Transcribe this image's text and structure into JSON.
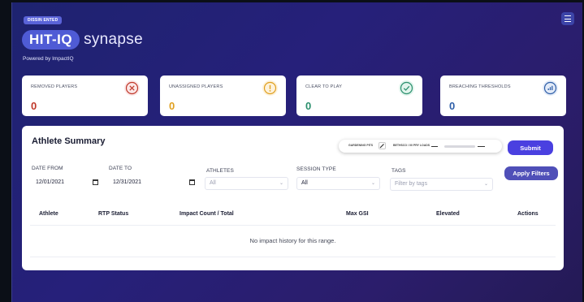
{
  "header": {
    "env_tag": "DISSIN ENTED",
    "logo_badge": "HIT-IQ",
    "logo_word": "synapse",
    "powered_by": "Powered by ImpactIQ"
  },
  "stats": [
    {
      "label": "REMOVED PLAYERS",
      "value": "0",
      "color": "#c0392b",
      "icon": "x-circle-icon"
    },
    {
      "label": "UNASSIGNED PLAYERS",
      "value": "0",
      "color": "#e0a020",
      "icon": "exclamation-icon"
    },
    {
      "label": "CLEAR TO PLAY",
      "value": "0",
      "color": "#2a8f6d",
      "icon": "check-circle-icon"
    },
    {
      "label": "BREACHING THRESHOLDS",
      "value": "0",
      "color": "#2f5fa8",
      "icon": "bar-chart-icon"
    }
  ],
  "panel": {
    "title": "Athlete Summary",
    "pitch_left": "GARDENING PITS",
    "pitch_mid": "BETHSCO / 00 PRY LOADS",
    "submit": "Submit",
    "apply_filters": "Apply Filters"
  },
  "filters": {
    "date_from_label": "DATE FROM",
    "date_from": "12/01/2021",
    "date_to_label": "DATE TO",
    "date_to": "12/31/2021",
    "athletes_label": "ATHLETES",
    "athletes_value": "All",
    "session_label": "SESSION TYPE",
    "session_value": "All",
    "tags_label": "TAGS",
    "tags_placeholder": "Filter by tags"
  },
  "table": {
    "columns": [
      "Athlete",
      "RTP Status",
      "Impact Count / Total",
      "Max GSI",
      "Elevated",
      "Actions"
    ],
    "empty_message": "No impact history for this range."
  },
  "colors": {
    "accent": "#4a40e0",
    "background": "#1e2370"
  }
}
